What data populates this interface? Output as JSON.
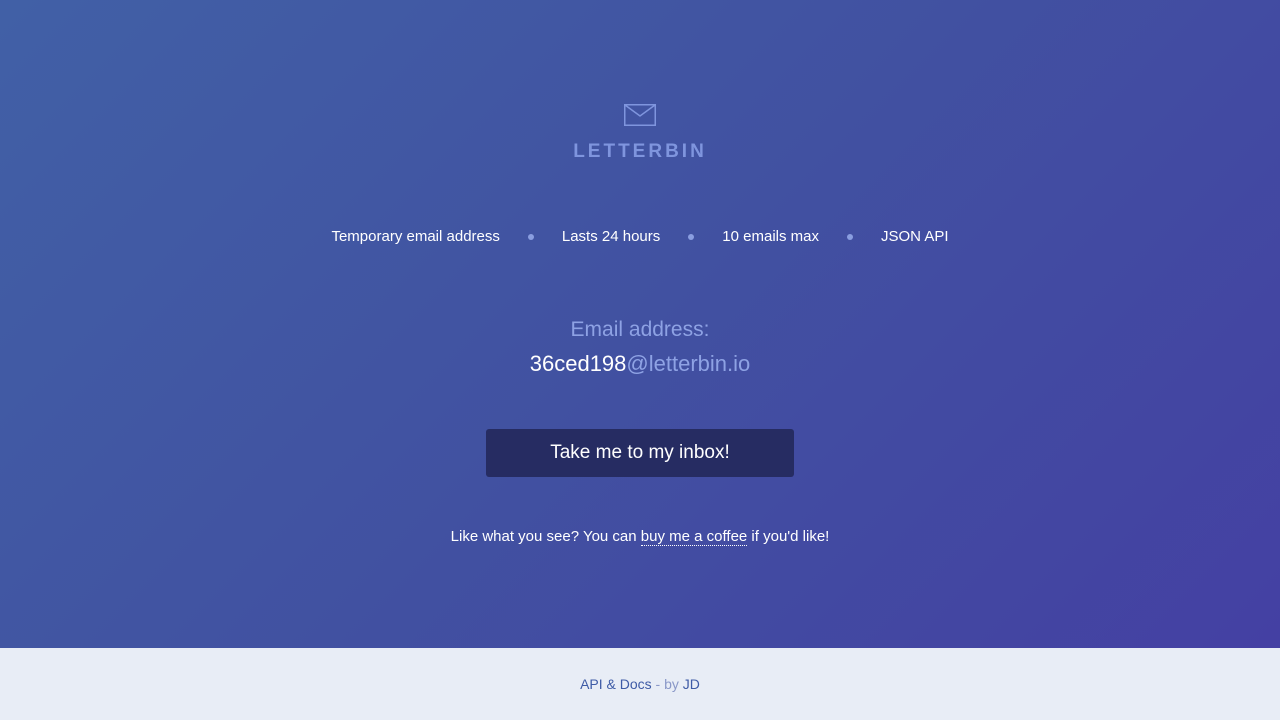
{
  "brand": {
    "name": "LETTERBIN",
    "icon": "envelope-icon"
  },
  "features": [
    "Temporary email address",
    "Lasts 24 hours",
    "10 emails max",
    "JSON API"
  ],
  "email": {
    "label": "Email address:",
    "local_part": "36ced198",
    "domain": "@letterbin.io"
  },
  "inbox_button": {
    "label": "Take me to my inbox!"
  },
  "coffee": {
    "prefix": "Like what you see? You can ",
    "link": "buy me a coffee",
    "suffix": " if you'd like!"
  },
  "footer": {
    "api_docs": "API & Docs",
    "separator": " - by ",
    "author": "JD"
  },
  "colors": {
    "hero_gradient_start": "#4160a6",
    "hero_gradient_end": "#4440a3",
    "accent_light": "#8ea2e4",
    "button_bg": "#262c62",
    "footer_bg": "#e8edf6"
  }
}
